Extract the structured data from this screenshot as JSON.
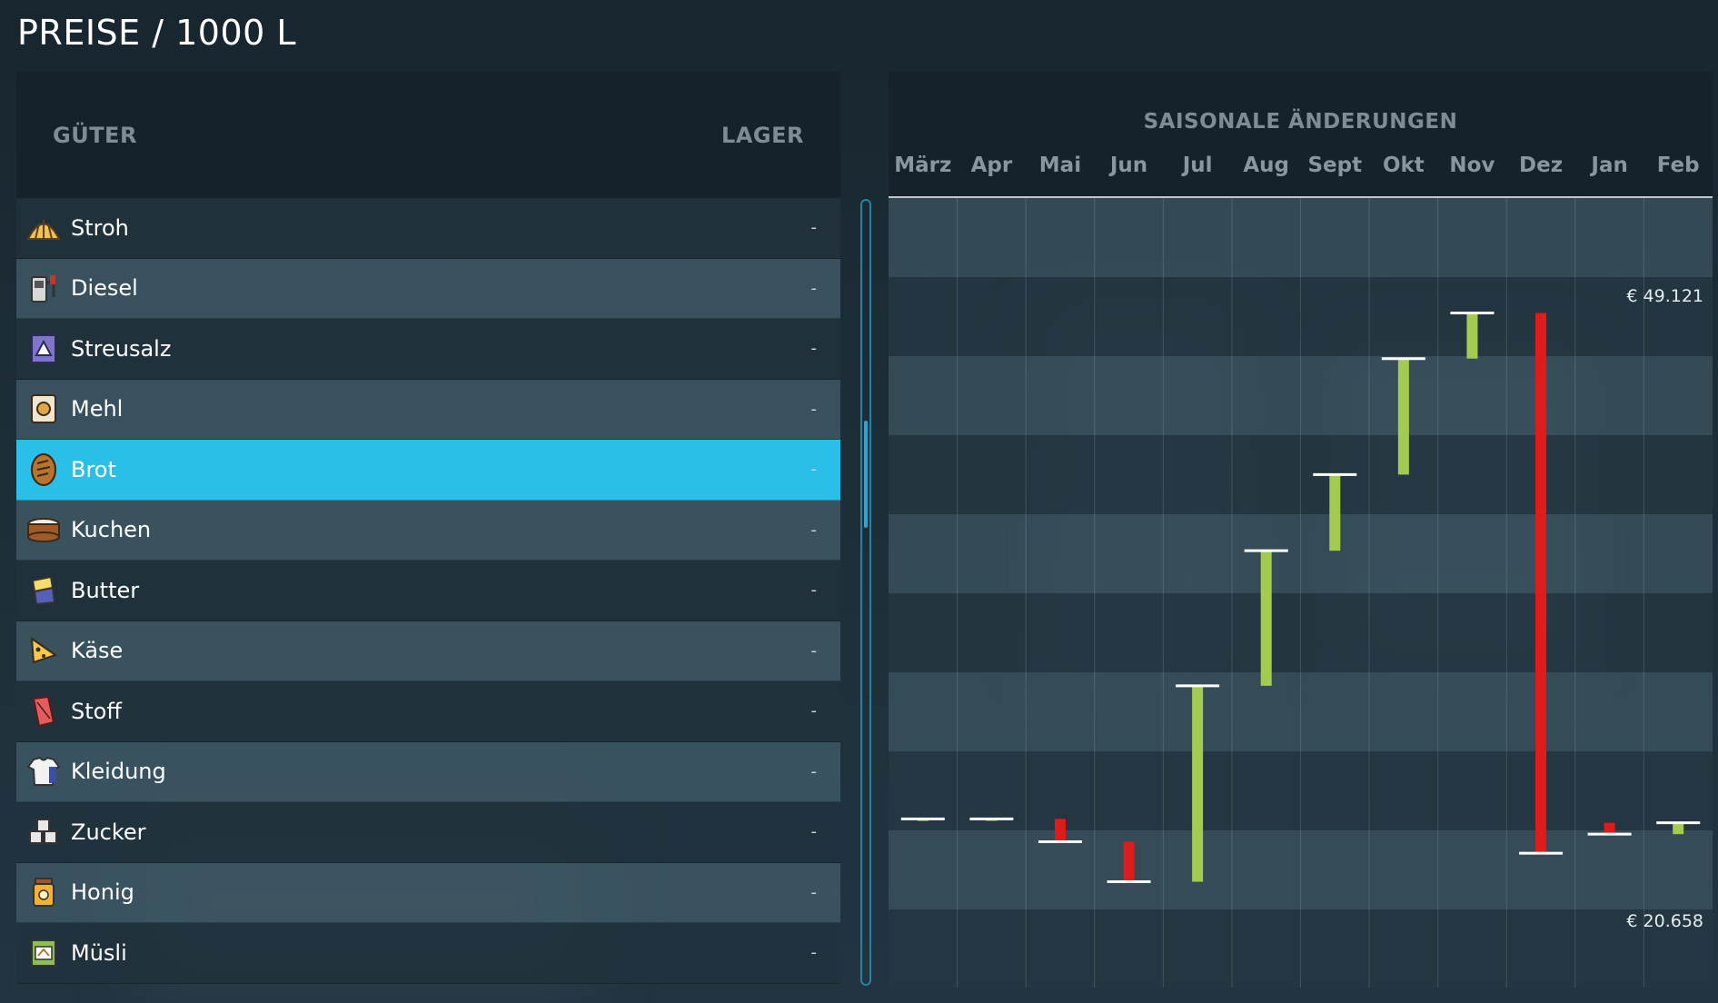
{
  "page_title": "PREISE / 1000 L",
  "goods": {
    "header_goods": "GÜTER",
    "header_stock": "LAGER",
    "items": [
      {
        "name": "Stroh",
        "stock": "-",
        "icon": "straw-icon"
      },
      {
        "name": "Diesel",
        "stock": "-",
        "icon": "fuel-pump-icon"
      },
      {
        "name": "Streusalz",
        "stock": "-",
        "icon": "road-salt-icon"
      },
      {
        "name": "Mehl",
        "stock": "-",
        "icon": "flour-sack-icon"
      },
      {
        "name": "Brot",
        "stock": "-",
        "icon": "bread-icon",
        "selected": true
      },
      {
        "name": "Kuchen",
        "stock": "-",
        "icon": "cake-icon"
      },
      {
        "name": "Butter",
        "stock": "-",
        "icon": "butter-icon"
      },
      {
        "name": "Käse",
        "stock": "-",
        "icon": "cheese-icon"
      },
      {
        "name": "Stoff",
        "stock": "-",
        "icon": "fabric-icon"
      },
      {
        "name": "Kleidung",
        "stock": "-",
        "icon": "clothing-icon"
      },
      {
        "name": "Zucker",
        "stock": "-",
        "icon": "sugar-cubes-icon"
      },
      {
        "name": "Honig",
        "stock": "-",
        "icon": "honey-jar-icon"
      },
      {
        "name": "Müsli",
        "stock": "-",
        "icon": "cereal-icon"
      }
    ]
  },
  "chart": {
    "title": "SAISONALE ÄNDERUNGEN",
    "max_label": "€ 49.121",
    "min_label": "€ 20.658",
    "colors": {
      "increase": "#a3cb4f",
      "decrease": "#e01b1b",
      "marker": "#ffffff"
    }
  },
  "chart_data": {
    "type": "bar",
    "categories": [
      "März",
      "Apr",
      "Mai",
      "Jun",
      "Jul",
      "Aug",
      "Sept",
      "Okt",
      "Nov",
      "Dez",
      "Jan",
      "Feb"
    ],
    "series": [
      {
        "values_start": [
          22.4,
          22.5,
          22.5,
          21.3,
          19.2,
          29.5,
          36.6,
          40.6,
          46.7,
          49.1,
          22.3,
          21.7
        ],
        "values_end": [
          22.5,
          22.5,
          21.3,
          19.2,
          29.5,
          36.6,
          40.6,
          46.7,
          49.1,
          20.7,
          21.7,
          22.3
        ]
      }
    ],
    "ylim": [
      20.658,
      49.121
    ]
  }
}
